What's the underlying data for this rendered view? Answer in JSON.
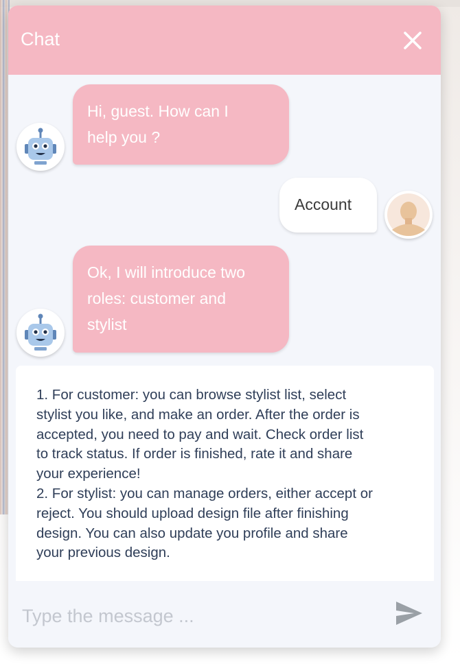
{
  "header": {
    "title": "Chat",
    "close_icon": "close-icon"
  },
  "messages": [
    {
      "sender": "bot",
      "lines": [
        "Hi, guest. How can I",
        "help you ?"
      ],
      "avatar_icon": "robot-icon"
    },
    {
      "sender": "user",
      "lines": [
        "Account"
      ],
      "avatar_icon": "user-avatar-icon"
    },
    {
      "sender": "bot",
      "lines": [
        "Ok, I will introduce two",
        "roles: customer and",
        "stylist"
      ],
      "avatar_icon": "robot-icon"
    }
  ],
  "info_card": {
    "lines": [
      "1. For customer: you can browse stylist list, select",
      "stylist you like, and make an order. After the order is",
      "accepted, you need to pay and wait. Check order list",
      "to track status. If order is finished, rate it and share",
      "your experience!",
      "2. For stylist: you can manage orders, either accept or",
      "reject. You should upload design file after finishing",
      "design. You can also update you profile and share",
      "your previous design."
    ]
  },
  "input": {
    "placeholder": "Type the message ...",
    "value": "",
    "send_icon": "send-icon"
  },
  "colors": {
    "header_bg": "#f5b8c3",
    "bot_bubble": "#f5b8c3",
    "chat_bg": "#f4f6fb",
    "info_text": "#2f3e58"
  }
}
